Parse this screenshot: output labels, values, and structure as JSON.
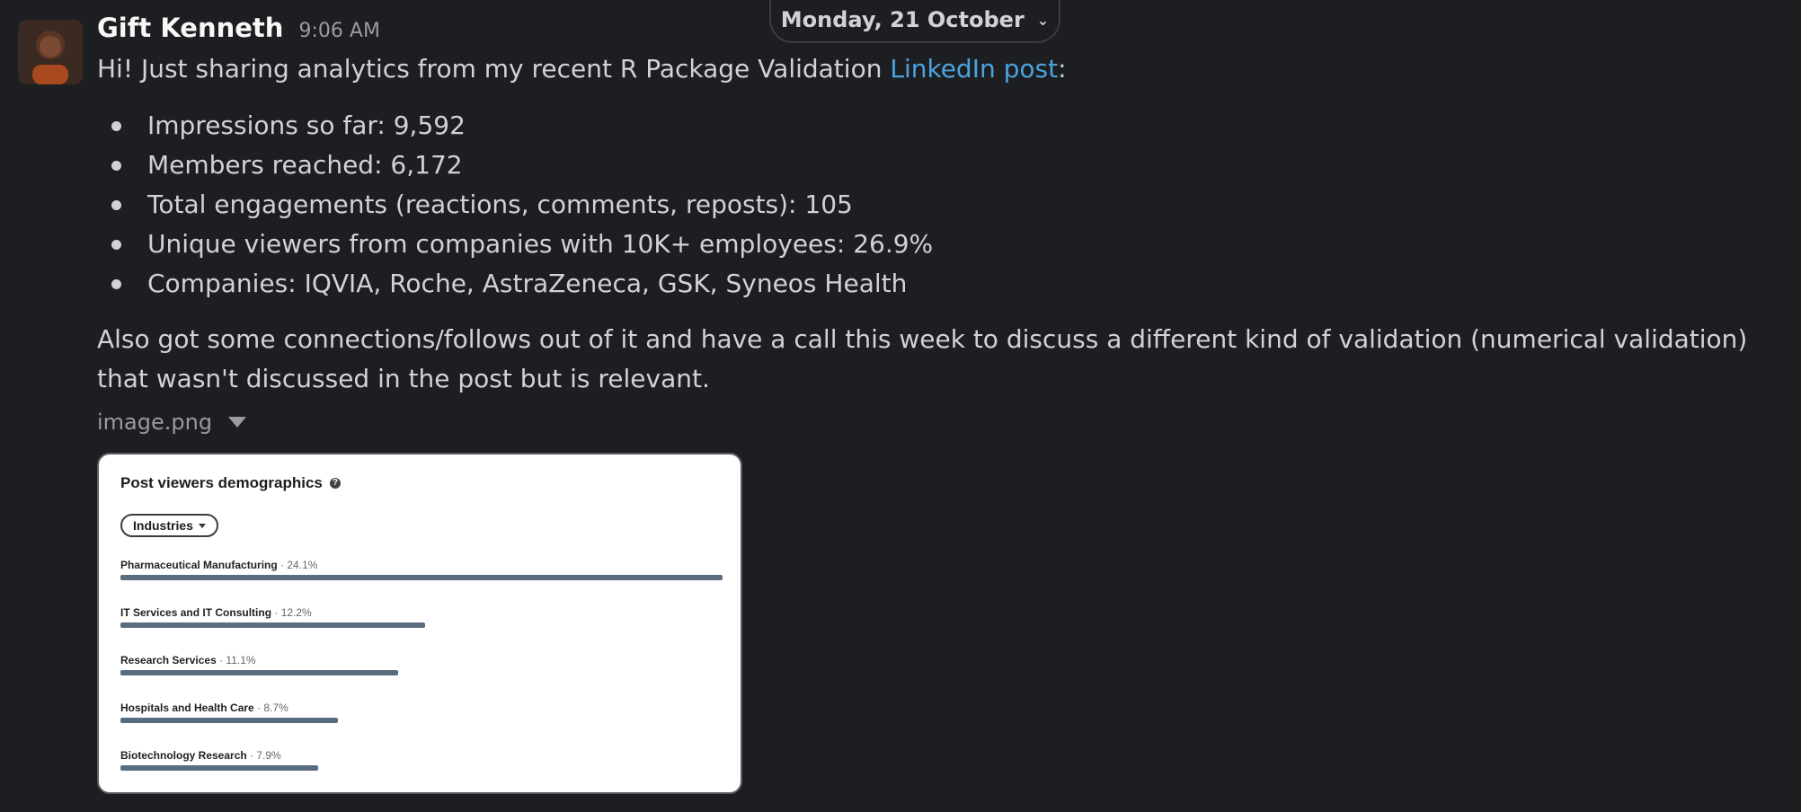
{
  "date_divider": {
    "label": "Monday, 21 October"
  },
  "message": {
    "sender": "Gift Kenneth",
    "time": "9:06 AM",
    "intro_text": "Hi! Just sharing analytics from my recent R Package Validation",
    "link_text": "LinkedIn post",
    "intro_suffix": ":",
    "bullets": [
      "Impressions so far: 9,592",
      "Members reached: 6,172",
      "Total engagements (reactions, comments, reposts): 105",
      "Unique viewers from companies with 10K+ employees: 26.9%",
      "Companies: IQVIA, Roche, AstraZeneca, GSK, Syneos Health"
    ],
    "paragraph": "Also got some connections/follows out of it and have a call this week to discuss a different kind of validation (numerical validation) that wasn't discussed in the post but is relevant.",
    "attachment_name": "image.png"
  },
  "attachment_card": {
    "title": "Post viewers demographics",
    "dropdown_label": "Industries"
  },
  "chart_data": {
    "type": "bar",
    "title": "Post viewers demographics",
    "categories": [
      "Pharmaceutical Manufacturing",
      "IT Services and IT Consulting",
      "Research Services",
      "Hospitals and Health Care",
      "Biotechnology Research"
    ],
    "value_labels": [
      "24.1%",
      "12.2%",
      "11.1%",
      "8.7%",
      "7.9%"
    ],
    "values": [
      24.1,
      12.2,
      11.1,
      8.7,
      7.9
    ],
    "orientation": "horizontal",
    "bar_color": "#5a6d80"
  }
}
